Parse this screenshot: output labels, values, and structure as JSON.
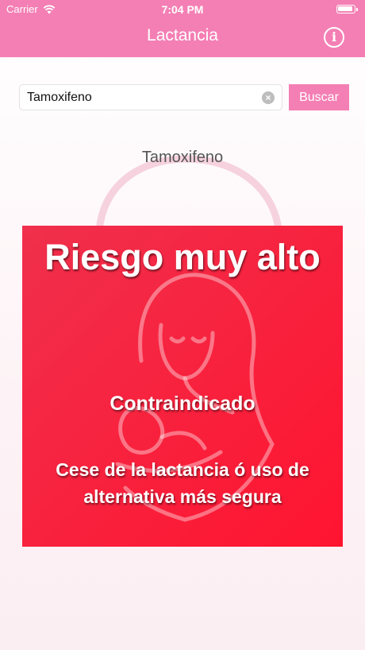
{
  "status_bar": {
    "carrier": "Carrier",
    "time": "7:04 PM",
    "wifi_icon": "wifi-icon",
    "battery_icon": "battery-icon"
  },
  "nav": {
    "title": "Lactancia",
    "info_icon": "info-icon",
    "info_glyph": "i"
  },
  "search": {
    "value": "Tamoxifeno",
    "clear_icon": "clear-icon",
    "button_label": "Buscar"
  },
  "result": {
    "drug_name": "Tamoxifeno",
    "risk_level": "Riesgo muy alto",
    "category": "Contraindicado",
    "recommendation": "Cese de la lactancia ó uso de alternativa más segura"
  },
  "colors": {
    "header_pink": "#f47fb4",
    "card_red": "#ff1430",
    "text_white": "#ffffff"
  }
}
